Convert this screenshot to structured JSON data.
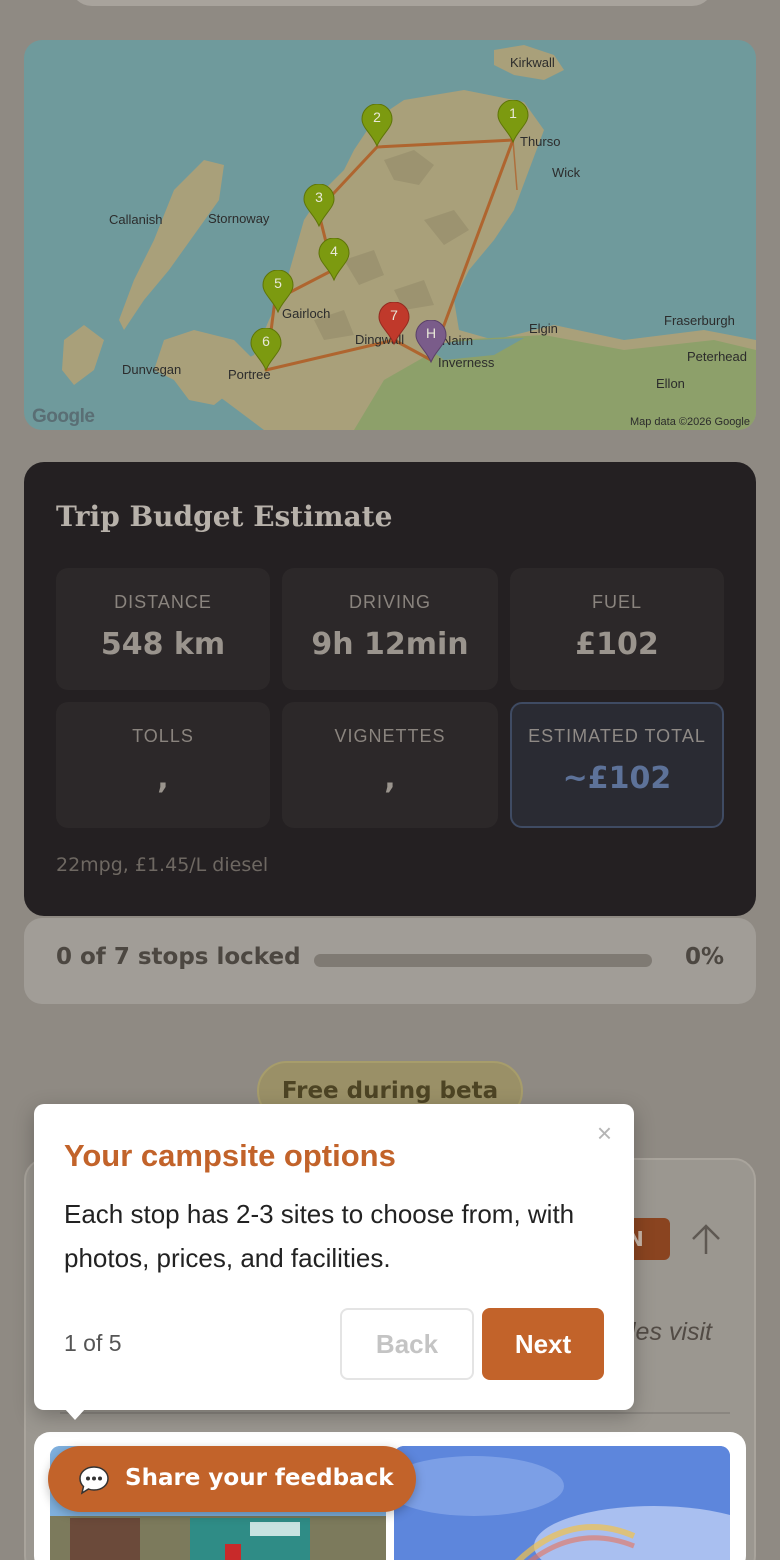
{
  "map": {
    "towns": [
      "Kirkwall",
      "Thurso",
      "Wick",
      "Callanish",
      "Stornoway",
      "Gairloch",
      "Dingwall",
      "Nairn",
      "Inverness",
      "Elgin",
      "Fraserburgh",
      "Peterhead",
      "Ellon",
      "Dunvegan",
      "Portree"
    ],
    "pins": [
      {
        "label": "1",
        "color": "#7c9a10"
      },
      {
        "label": "2",
        "color": "#7c9a10"
      },
      {
        "label": "3",
        "color": "#7c9a10"
      },
      {
        "label": "4",
        "color": "#7c9a10"
      },
      {
        "label": "5",
        "color": "#7c9a10"
      },
      {
        "label": "6",
        "color": "#7c9a10"
      },
      {
        "label": "7",
        "color": "#c0392b"
      },
      {
        "label": "H",
        "color": "#7a5c8a"
      }
    ],
    "google_logo": "Google",
    "credit": "Map data ©2026 Google"
  },
  "budget": {
    "title": "Trip Budget Estimate",
    "stats": [
      {
        "label": "DISTANCE",
        "value": "548 km"
      },
      {
        "label": "DRIVING",
        "value": "9h 12min"
      },
      {
        "label": "FUEL",
        "value": "£102"
      },
      {
        "label": "TOLLS",
        "value": ","
      },
      {
        "label": "VIGNETTES",
        "value": ","
      },
      {
        "label": "ESTIMATED TOTAL",
        "value": "~£102"
      }
    ],
    "note": "22mpg, £1.45/L diesel"
  },
  "progress": {
    "text": "0 of 7 stops locked",
    "percent_label": "0%",
    "fraction": 0
  },
  "beta_badge": "Free during beta",
  "background_card": {
    "badge_text": "ON",
    "italic_text": "les visit"
  },
  "tooltip": {
    "close": "×",
    "title": "Your campsite options",
    "body": "Each stop has 2-3 sites to choose from, with photos, prices, and facilities.",
    "step": "1 of 5",
    "back_label": "Back",
    "next_label": "Next"
  },
  "feedback": {
    "label": "Share your feedback",
    "icon": "speech-bubble-icon"
  },
  "colors": {
    "accent": "#c2632a",
    "budget_bg": "#242022",
    "total_value": "#5d7299"
  }
}
